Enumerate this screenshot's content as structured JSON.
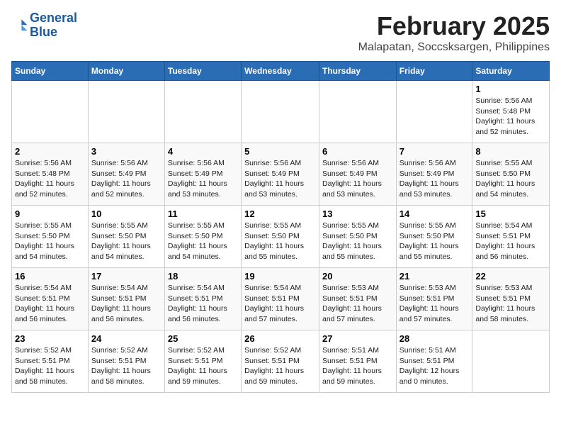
{
  "header": {
    "logo_line1": "General",
    "logo_line2": "Blue",
    "title": "February 2025",
    "subtitle": "Malapatan, Soccsksargen, Philippines"
  },
  "columns": [
    "Sunday",
    "Monday",
    "Tuesday",
    "Wednesday",
    "Thursday",
    "Friday",
    "Saturday"
  ],
  "weeks": [
    [
      {
        "day": "",
        "info": ""
      },
      {
        "day": "",
        "info": ""
      },
      {
        "day": "",
        "info": ""
      },
      {
        "day": "",
        "info": ""
      },
      {
        "day": "",
        "info": ""
      },
      {
        "day": "",
        "info": ""
      },
      {
        "day": "1",
        "info": "Sunrise: 5:56 AM\nSunset: 5:48 PM\nDaylight: 11 hours\nand 52 minutes."
      }
    ],
    [
      {
        "day": "2",
        "info": "Sunrise: 5:56 AM\nSunset: 5:48 PM\nDaylight: 11 hours\nand 52 minutes."
      },
      {
        "day": "3",
        "info": "Sunrise: 5:56 AM\nSunset: 5:49 PM\nDaylight: 11 hours\nand 52 minutes."
      },
      {
        "day": "4",
        "info": "Sunrise: 5:56 AM\nSunset: 5:49 PM\nDaylight: 11 hours\nand 53 minutes."
      },
      {
        "day": "5",
        "info": "Sunrise: 5:56 AM\nSunset: 5:49 PM\nDaylight: 11 hours\nand 53 minutes."
      },
      {
        "day": "6",
        "info": "Sunrise: 5:56 AM\nSunset: 5:49 PM\nDaylight: 11 hours\nand 53 minutes."
      },
      {
        "day": "7",
        "info": "Sunrise: 5:56 AM\nSunset: 5:49 PM\nDaylight: 11 hours\nand 53 minutes."
      },
      {
        "day": "8",
        "info": "Sunrise: 5:55 AM\nSunset: 5:50 PM\nDaylight: 11 hours\nand 54 minutes."
      }
    ],
    [
      {
        "day": "9",
        "info": "Sunrise: 5:55 AM\nSunset: 5:50 PM\nDaylight: 11 hours\nand 54 minutes."
      },
      {
        "day": "10",
        "info": "Sunrise: 5:55 AM\nSunset: 5:50 PM\nDaylight: 11 hours\nand 54 minutes."
      },
      {
        "day": "11",
        "info": "Sunrise: 5:55 AM\nSunset: 5:50 PM\nDaylight: 11 hours\nand 54 minutes."
      },
      {
        "day": "12",
        "info": "Sunrise: 5:55 AM\nSunset: 5:50 PM\nDaylight: 11 hours\nand 55 minutes."
      },
      {
        "day": "13",
        "info": "Sunrise: 5:55 AM\nSunset: 5:50 PM\nDaylight: 11 hours\nand 55 minutes."
      },
      {
        "day": "14",
        "info": "Sunrise: 5:55 AM\nSunset: 5:50 PM\nDaylight: 11 hours\nand 55 minutes."
      },
      {
        "day": "15",
        "info": "Sunrise: 5:54 AM\nSunset: 5:51 PM\nDaylight: 11 hours\nand 56 minutes."
      }
    ],
    [
      {
        "day": "16",
        "info": "Sunrise: 5:54 AM\nSunset: 5:51 PM\nDaylight: 11 hours\nand 56 minutes."
      },
      {
        "day": "17",
        "info": "Sunrise: 5:54 AM\nSunset: 5:51 PM\nDaylight: 11 hours\nand 56 minutes."
      },
      {
        "day": "18",
        "info": "Sunrise: 5:54 AM\nSunset: 5:51 PM\nDaylight: 11 hours\nand 56 minutes."
      },
      {
        "day": "19",
        "info": "Sunrise: 5:54 AM\nSunset: 5:51 PM\nDaylight: 11 hours\nand 57 minutes."
      },
      {
        "day": "20",
        "info": "Sunrise: 5:53 AM\nSunset: 5:51 PM\nDaylight: 11 hours\nand 57 minutes."
      },
      {
        "day": "21",
        "info": "Sunrise: 5:53 AM\nSunset: 5:51 PM\nDaylight: 11 hours\nand 57 minutes."
      },
      {
        "day": "22",
        "info": "Sunrise: 5:53 AM\nSunset: 5:51 PM\nDaylight: 11 hours\nand 58 minutes."
      }
    ],
    [
      {
        "day": "23",
        "info": "Sunrise: 5:52 AM\nSunset: 5:51 PM\nDaylight: 11 hours\nand 58 minutes."
      },
      {
        "day": "24",
        "info": "Sunrise: 5:52 AM\nSunset: 5:51 PM\nDaylight: 11 hours\nand 58 minutes."
      },
      {
        "day": "25",
        "info": "Sunrise: 5:52 AM\nSunset: 5:51 PM\nDaylight: 11 hours\nand 59 minutes."
      },
      {
        "day": "26",
        "info": "Sunrise: 5:52 AM\nSunset: 5:51 PM\nDaylight: 11 hours\nand 59 minutes."
      },
      {
        "day": "27",
        "info": "Sunrise: 5:51 AM\nSunset: 5:51 PM\nDaylight: 11 hours\nand 59 minutes."
      },
      {
        "day": "28",
        "info": "Sunrise: 5:51 AM\nSunset: 5:51 PM\nDaylight: 12 hours\nand 0 minutes."
      },
      {
        "day": "",
        "info": ""
      }
    ]
  ]
}
